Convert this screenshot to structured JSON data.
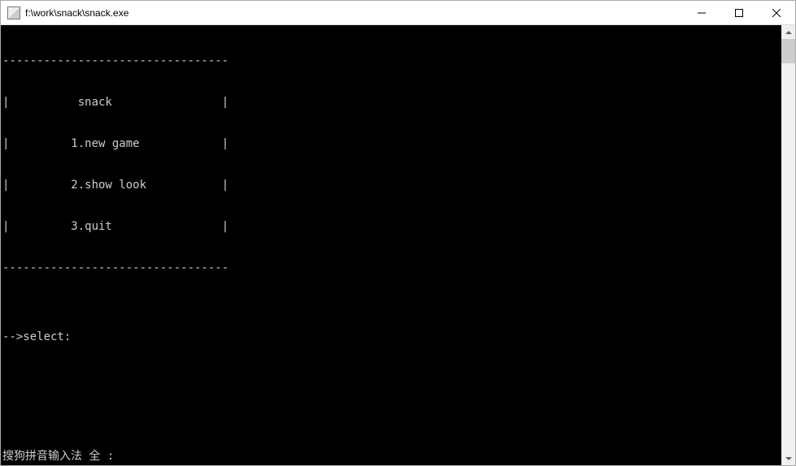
{
  "window": {
    "title": "f:\\work\\snack\\snack.exe"
  },
  "console": {
    "border_top": "---------------------------------",
    "title_line": "|          snack                |",
    "menu_items": [
      "|         1.new game            |",
      "|         2.show look           |",
      "|         3.quit                |"
    ],
    "border_bottom": "---------------------------------",
    "blank": "",
    "prompt": "-->select:",
    "ime_status": "搜狗拼音输入法 全 :"
  }
}
